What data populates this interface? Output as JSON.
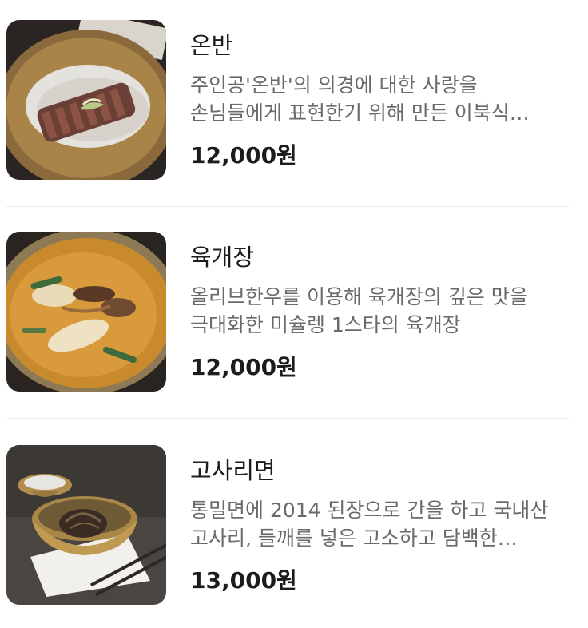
{
  "menu_items": [
    {
      "name": "온반",
      "description": "주인공'온반'의 의경에 대한 사랑을 손님들에게 표현한기 위해 만든 이북식 국밥으로 정성을 담았습니다",
      "price": "12,000원"
    },
    {
      "name": "육개장",
      "description": "올리브한우를 이용해 육개장의 깊은 맛을 극대화한 미슐렝 1스타의 육개장",
      "price": "12,000원"
    },
    {
      "name": "고사리면",
      "description": "통밀면에 2014 된장으로 간을 하고 국내산 고사리, 들깨를 넣은 고소하고 담백한 면요리입니다",
      "price": "13,000원"
    }
  ]
}
